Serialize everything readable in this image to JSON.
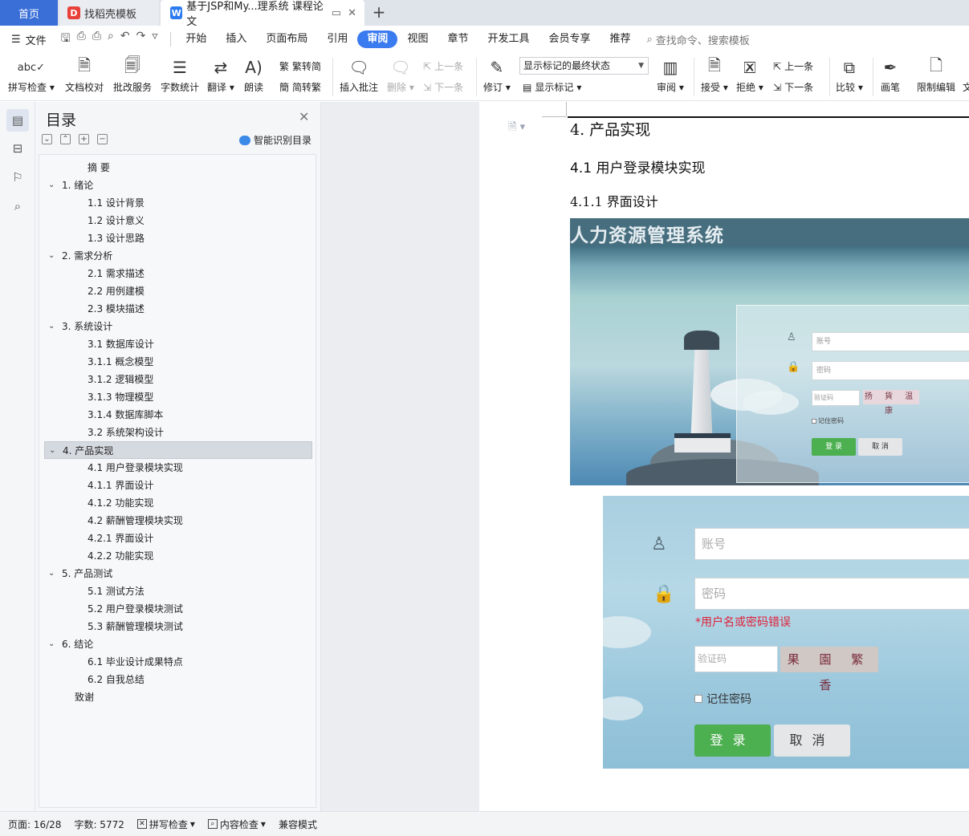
{
  "tabs": {
    "home": "首页",
    "template": "找稻壳模板",
    "document": "基于JSP和My...理系统 课程论文",
    "add": "+"
  },
  "menubar": {
    "file": "文件",
    "items": [
      "开始",
      "插入",
      "页面布局",
      "引用",
      "审阅",
      "视图",
      "章节",
      "开发工具",
      "会员专享",
      "推荐"
    ],
    "active_index": 4,
    "search": "查找命令、搜索模板"
  },
  "ribbon": {
    "spellcheck": "拼写检查",
    "doc_proof": "文档校对",
    "revision_service": "批改服务",
    "word_count": "字数统计",
    "translate": "翻译",
    "read_aloud": "朗读",
    "to_simplified": "繁转简",
    "to_traditional": "简转繁",
    "insert_comment": "插入批注",
    "delete": "删除",
    "prev": "上一条",
    "next": "下一条",
    "revise": "修订",
    "markup_state": "显示标记的最终状态",
    "show_markup": "显示标记",
    "review": "审阅",
    "accept": "接受",
    "reject": "拒绝",
    "prev2": "上一条",
    "next2": "下一条",
    "compare": "比较",
    "pen": "画笔",
    "restrict_edit": "限制编辑",
    "doc_cut": "文"
  },
  "toc": {
    "title": "目录",
    "smart": "智能识别目录",
    "items": [
      {
        "label": "摘 要",
        "level": 0,
        "chev": false
      },
      {
        "label": "1.  绪论",
        "level": 1,
        "chev": true
      },
      {
        "label": "1.1 设计背景",
        "level": 2,
        "chev": false
      },
      {
        "label": "1.2 设计意义",
        "level": 2,
        "chev": false
      },
      {
        "label": "1.3 设计思路",
        "level": 2,
        "chev": false
      },
      {
        "label": "2. 需求分析",
        "level": 1,
        "chev": true
      },
      {
        "label": "2.1 需求描述",
        "level": 2,
        "chev": false
      },
      {
        "label": "2.2 用例建模",
        "level": 2,
        "chev": false
      },
      {
        "label": "2.3 模块描述",
        "level": 2,
        "chev": false
      },
      {
        "label": "3. 系统设计",
        "level": 1,
        "chev": true
      },
      {
        "label": "3.1 数据库设计",
        "level": 2,
        "chev": false
      },
      {
        "label": "3.1.1 概念模型",
        "level": 2,
        "chev": false
      },
      {
        "label": "3.1.2 逻辑模型",
        "level": 2,
        "chev": false
      },
      {
        "label": "3.1.3 物理模型",
        "level": 2,
        "chev": false
      },
      {
        "label": "3.1.4 数据库脚本",
        "level": 2,
        "chev": false
      },
      {
        "label": "3.2 系统架构设计",
        "level": 2,
        "chev": false
      },
      {
        "label": "4. 产品实现",
        "level": 1,
        "chev": true,
        "selected": true
      },
      {
        "label": "4.1 用户登录模块实现",
        "level": 2,
        "chev": false
      },
      {
        "label": "4.1.1 界面设计",
        "level": 2,
        "chev": false
      },
      {
        "label": "4.1.2 功能实现",
        "level": 2,
        "chev": false
      },
      {
        "label": "4.2 薪酬管理模块实现",
        "level": 2,
        "chev": false
      },
      {
        "label": "4.2.1 界面设计",
        "level": 2,
        "chev": false
      },
      {
        "label": "4.2.2 功能实现",
        "level": 2,
        "chev": false
      },
      {
        "label": "5. 产品测试",
        "level": 1,
        "chev": true
      },
      {
        "label": "5.1 测试方法",
        "level": 2,
        "chev": false
      },
      {
        "label": "5.2 用户登录模块测试",
        "level": 2,
        "chev": false
      },
      {
        "label": "5.3 薪酬管理模块测试",
        "level": 2,
        "chev": false
      },
      {
        "label": "6. 结论",
        "level": 1,
        "chev": true
      },
      {
        "label": "6.1 毕业设计成果特点",
        "level": 2,
        "chev": false
      },
      {
        "label": "6.2 自我总结",
        "level": 2,
        "chev": false
      },
      {
        "label": "致谢",
        "level": 3,
        "chev": false
      }
    ]
  },
  "document": {
    "h1": "4. 产品实现",
    "h2": "4.1 用户登录模块实现",
    "h3": "4.1.1 界面设计",
    "shot1": {
      "title": "人力资源管理系统",
      "account_ph": "账号",
      "password_ph": "密码",
      "captcha_ph": "验证码",
      "captcha": "扬 貨 温 康",
      "remember": "记住密码",
      "login": "登 录",
      "cancel": "取 消"
    },
    "shot2": {
      "account_ph": "账号",
      "password_ph": "密码",
      "error": "*用户名或密码错误",
      "captcha_ph": "验证码",
      "captcha": "果 園 繁 香",
      "remember": "记住密码",
      "login": "登录",
      "cancel": "取消"
    }
  },
  "status": {
    "page": "页面: 16/28",
    "words": "字数: 5772",
    "spell": "拼写检查",
    "content": "内容检查",
    "compat": "兼容模式"
  },
  "colors": {
    "accent": "#3b7bf0",
    "home_tab": "#3b6fd8",
    "login_green": "#4caf50",
    "error_red": "#e0213a"
  }
}
